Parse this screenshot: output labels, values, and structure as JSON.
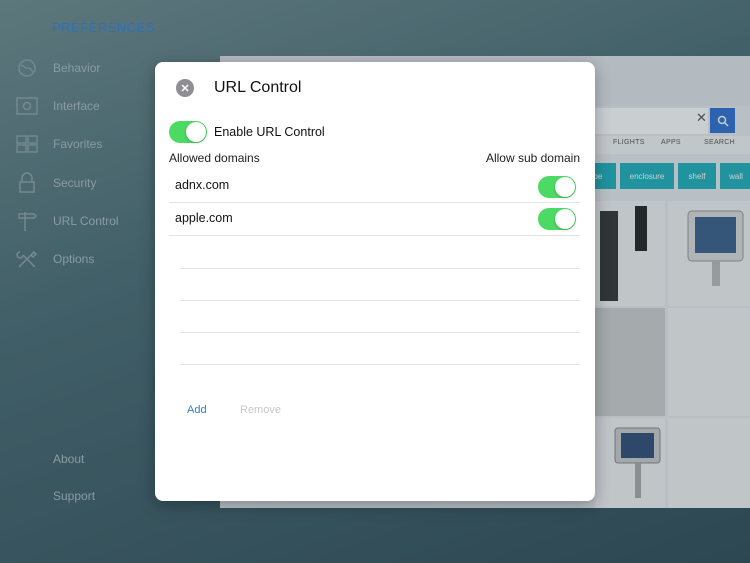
{
  "sidebar": {
    "title": "PREFERENCES",
    "items": [
      {
        "label": "Behavior",
        "icon": "globe-icon"
      },
      {
        "label": "Interface",
        "icon": "screen-gear-icon"
      },
      {
        "label": "Favorites",
        "icon": "grid-icon"
      },
      {
        "label": "Security",
        "icon": "lock-icon"
      },
      {
        "label": "URL Control",
        "icon": "signpost-icon"
      },
      {
        "label": "Options",
        "icon": "tools-icon"
      }
    ],
    "about": "About",
    "support": "Support"
  },
  "browser": {
    "tabs": [
      "FLIGHTS",
      "APPS",
      "SEARCH"
    ],
    "chips": [
      "pe",
      "enclosure",
      "shelf",
      "wall"
    ]
  },
  "modal": {
    "title": "URL Control",
    "enable_label": "Enable URL Control",
    "enable_on": true,
    "header_left": "Allowed domains",
    "header_right": "Allow sub domain",
    "domains": [
      {
        "name": "adnx.com",
        "sub": true
      },
      {
        "name": "apple.com",
        "sub": true
      }
    ],
    "add_label": "Add",
    "remove_label": "Remove"
  },
  "colors": {
    "accent": "#2f7fd0",
    "toggle_on": "#4cd964",
    "chip": "#1eb1bd"
  }
}
